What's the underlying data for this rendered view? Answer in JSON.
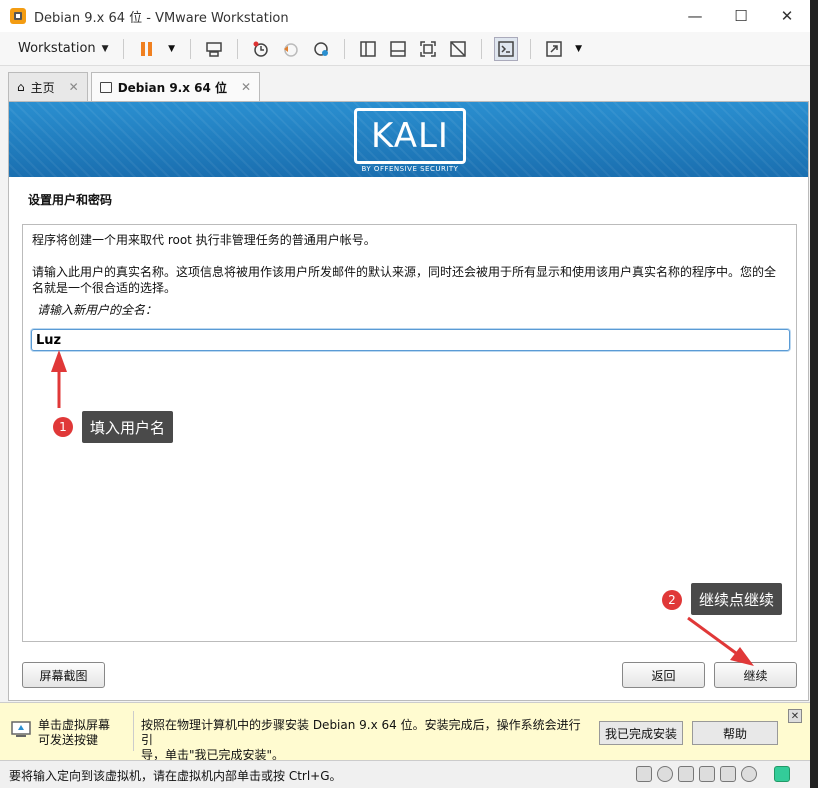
{
  "window": {
    "title": "Debian 9.x 64 位 - VMware Workstation",
    "minimize": "—",
    "maximize": "☐",
    "close": "✕"
  },
  "toolbar": {
    "menu_label": "Workstation",
    "menu_arrow": "▼",
    "icons": [
      "pause-icon",
      "send-keys-icon",
      "snapshot-icon",
      "revert-snapshot-icon",
      "snapshot-manager-icon",
      "sidebar-icon",
      "thumbnail-icon",
      "fullscreen-icon",
      "unity-icon",
      "console-icon",
      "stretch-icon"
    ]
  },
  "tabs": [
    {
      "label": "主页",
      "close": "✕",
      "icon": "home-icon"
    },
    {
      "label": "Debian 9.x 64 位",
      "close": "✕",
      "icon": "vm-icon"
    }
  ],
  "installer": {
    "logo_text": "KALI",
    "logo_subtitle": "BY OFFENSIVE SECURITY",
    "section_title": "设置用户和密码",
    "line1": "程序将创建一个用来取代 root 执行非管理任务的普通用户帐号。",
    "line2a": "请输入此用户的真实名称。这项信息将被用作该用户所发邮件的默认来源，同时还会被用于所有显示和使用该用户真实名称的程序中。您的全",
    "line2b": "名就是一个很合适的选择。",
    "prompt": "请输入新用户的全名：",
    "fullname_value": "Luz",
    "screenshot_button": "屏幕截图",
    "back_button": "返回",
    "continue_button": "继续"
  },
  "annotations": [
    {
      "number": "1",
      "label": "填入用户名"
    },
    {
      "number": "2",
      "label": "继续点继续"
    }
  ],
  "hint_bar": {
    "left_line1": "单击虚拟屏幕",
    "left_line2": "可发送按键",
    "main_line1": "按照在物理计算机中的步骤安装 Debian 9.x 64 位。安装完成后，操作系统会进行引",
    "main_line2": "导，单击\"我已完成安装\"。",
    "done_button": "我已完成安装",
    "help_button": "帮助",
    "close": "✕"
  },
  "status_bar": {
    "text": "要将输入定向到该虚拟机，请在虚拟机内部单击或按 Ctrl+G。"
  },
  "colors": {
    "kali_blue": "#2a8fd0",
    "annotation_red": "#e03838",
    "annotation_label_bg": "#4a4a4a",
    "hint_bg": "#fffbd0"
  }
}
